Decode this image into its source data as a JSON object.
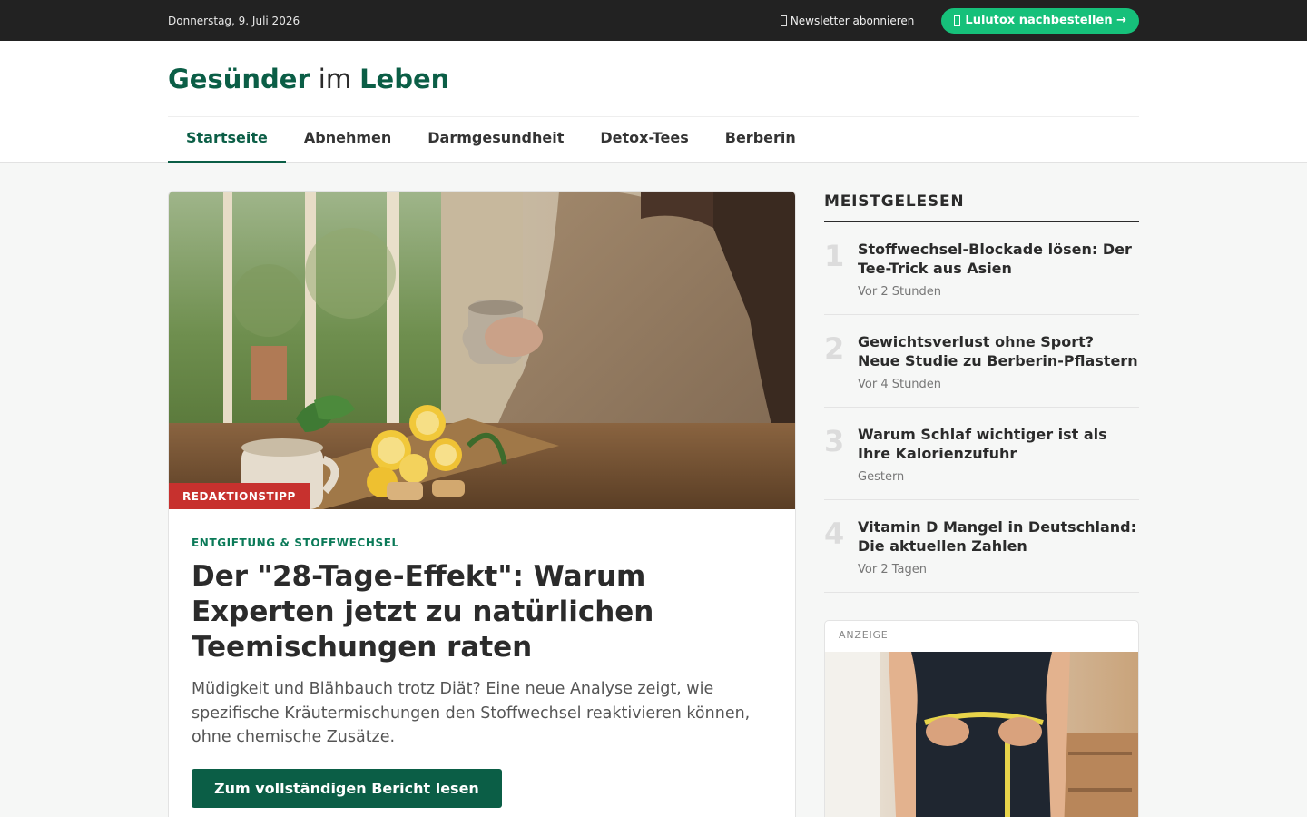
{
  "topbar": {
    "date": "Donnerstag, 9. Juli 2026",
    "newsletter_label": "Newsletter abonnieren",
    "order_label": "Lulutox nachbestellen →"
  },
  "header": {
    "logo_part1": "Gesünder",
    "logo_part2": "im",
    "logo_part3": "Leben"
  },
  "nav": {
    "items": [
      {
        "label": "Startseite",
        "active": true
      },
      {
        "label": "Abnehmen"
      },
      {
        "label": "Darmgesundheit"
      },
      {
        "label": "Detox-Tees"
      },
      {
        "label": "Berberin"
      }
    ]
  },
  "feature": {
    "badge": "REDAKTIONSTIPP",
    "kicker": "ENTGIFTUNG & STOFFWECHSEL",
    "headline": "Der \"28-Tage-Effekt\": Warum Experten jetzt zu natürlichen Teemischungen raten",
    "teaser": "Müdigkeit und Blähbauch trotz Diät? Eine neue Analyse zeigt, wie spezifische Kräutermischungen den Stoffwechsel reaktivieren können, ohne chemische Zusätze.",
    "cta_label": "Zum vollständigen Bericht lesen"
  },
  "sidebar": {
    "title": "MEISTGELESEN",
    "items": [
      {
        "num": "1",
        "title": "Stoffwechsel-Blockade lösen: Der Tee-Trick aus Asien",
        "time": "Vor 2 Stunden"
      },
      {
        "num": "2",
        "title": "Gewichtsverlust ohne Sport? Neue Studie zu Berberin-Pflastern",
        "time": "Vor 4 Stunden"
      },
      {
        "num": "3",
        "title": "Warum Schlaf wichtiger ist als Ihre Kalorienzufuhr",
        "time": "Gestern"
      },
      {
        "num": "4",
        "title": "Vitamin D Mangel in Deutschland: Die aktuellen Zahlen",
        "time": "Vor 2 Tagen"
      }
    ],
    "ad_label": "ANZEIGE"
  },
  "colors": {
    "brand": "#0b5e46",
    "accent_green": "#16c07a",
    "badge_red": "#c7312e",
    "topbar": "#222222"
  }
}
